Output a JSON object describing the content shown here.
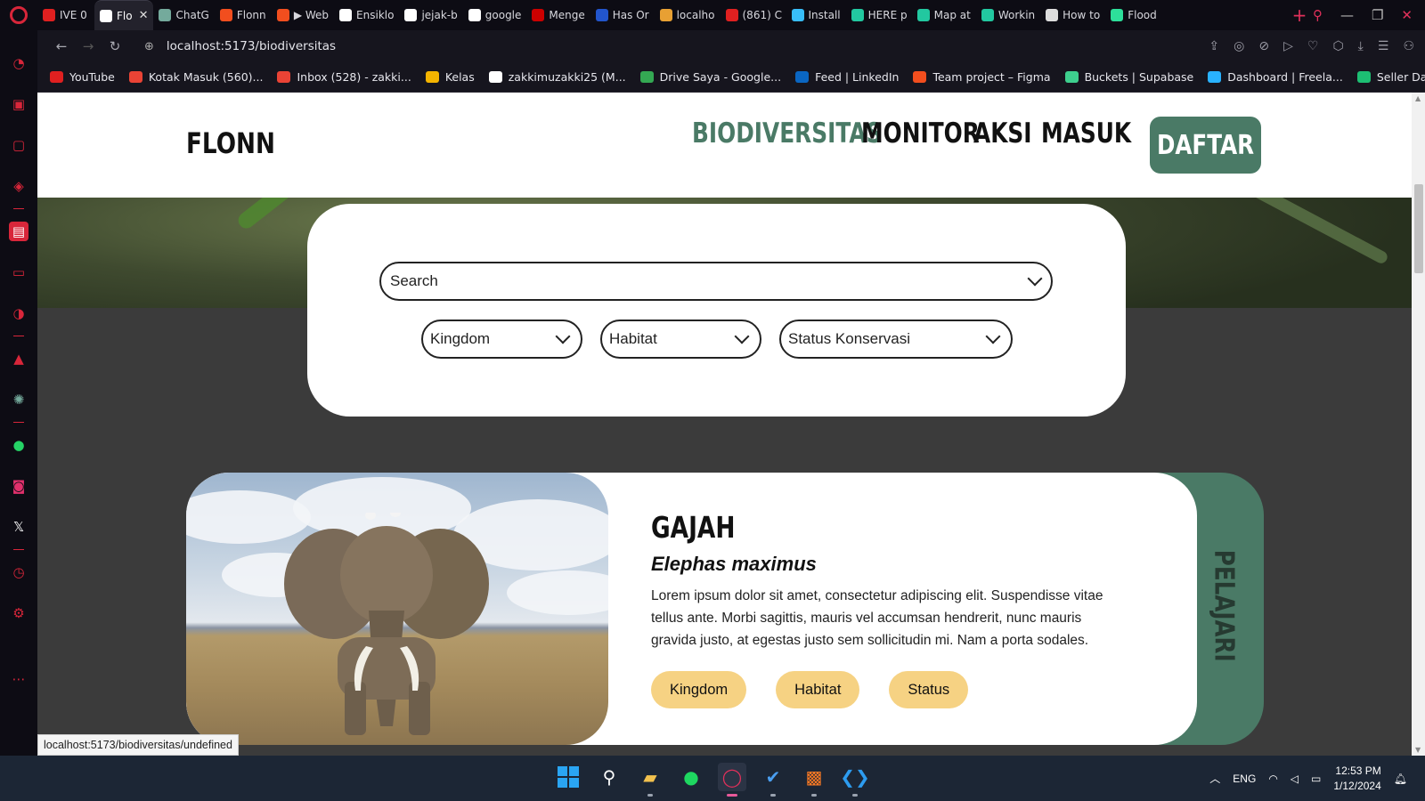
{
  "browser": {
    "tabs": [
      {
        "label": "IVE 0",
        "color": "#e02020"
      },
      {
        "label": "Flo",
        "color": "#ffffff",
        "active": true
      },
      {
        "label": "ChatG",
        "color": "#74aa9c"
      },
      {
        "label": "Flonn",
        "color": "#f24e1e"
      },
      {
        "label": "▶ Web",
        "color": "#f24e1e"
      },
      {
        "label": "Ensiklo",
        "color": "#ffffff"
      },
      {
        "label": "jejak-b",
        "color": "#ffffff"
      },
      {
        "label": "google",
        "color": "#ffffff"
      },
      {
        "label": "Menge",
        "color": "#cc0000"
      },
      {
        "label": "Has Or",
        "color": "#2255cc"
      },
      {
        "label": "localho",
        "color": "#e8a033"
      },
      {
        "label": "(861) C",
        "color": "#e02020"
      },
      {
        "label": "Install",
        "color": "#38bdf8"
      },
      {
        "label": "HERE p",
        "color": "#22c8a0"
      },
      {
        "label": "Map at",
        "color": "#22c8a0"
      },
      {
        "label": "Workin",
        "color": "#22c8a0"
      },
      {
        "label": "How to",
        "color": "#dddddd"
      },
      {
        "label": "Flood",
        "color": "#2ddf9a"
      }
    ],
    "new_tab_symbol": "+",
    "close_tab_symbol": "✕",
    "url": "localhost:5173/biodiversitas",
    "bookmarks": [
      {
        "label": "YouTube",
        "color": "#e02020"
      },
      {
        "label": "Kotak Masuk (560)...",
        "color": "#ea4335"
      },
      {
        "label": "Inbox (528) - zakki...",
        "color": "#ea4335"
      },
      {
        "label": "Kelas",
        "color": "#f4b400"
      },
      {
        "label": "zakkimuzakki25 (M...",
        "color": "#ffffff"
      },
      {
        "label": "Drive Saya - Google...",
        "color": "#34a853"
      },
      {
        "label": "Feed | LinkedIn",
        "color": "#0a66c2"
      },
      {
        "label": "Team project – Figma",
        "color": "#f24e1e"
      },
      {
        "label": "Buckets | Supabase",
        "color": "#3ecf8e"
      },
      {
        "label": "Dashboard | Freela...",
        "color": "#29b2fe"
      },
      {
        "label": "Seller Dashboard",
        "color": "#1dbf73"
      }
    ],
    "status_url": "localhost:5173/biodiversitas/undefined"
  },
  "site": {
    "brand": "FLONN",
    "nav": [
      "BIODIVERSITAS",
      "MONITOR",
      "AKSI",
      "MASUK"
    ],
    "cta": "DAFTAR",
    "accent": "#4a7a66"
  },
  "search": {
    "placeholder": "Search",
    "filters": [
      "Kingdom",
      "Habitat",
      "Status Konservasi"
    ]
  },
  "species": {
    "name": "GAJAH",
    "latin": "Elephas maximus",
    "description": "Lorem ipsum dolor sit amet, consectetur adipiscing elit. Suspendisse vitae tellus ante. Morbi sagittis, mauris vel accumsan hendrerit, nunc mauris gravida justo, at egestas justo sem sollicitudin mi. Nam a porta sodales. Etiam vitae lorem commodo odio.",
    "tags": [
      "Kingdom",
      "Habitat",
      "Status"
    ],
    "tag_color": "#f6d283",
    "learn": "PELAJARI"
  },
  "taskbar": {
    "lang": "ENG",
    "time": "12:53 PM",
    "date": "1/12/2024"
  }
}
